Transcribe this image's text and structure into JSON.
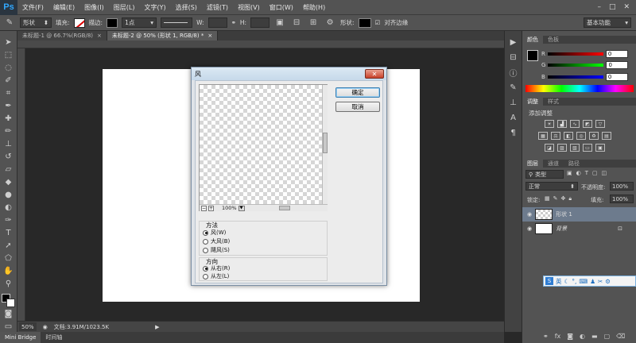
{
  "app": {
    "logo": "Ps"
  },
  "menu": [
    "文件(F)",
    "编辑(E)",
    "图像(I)",
    "图层(L)",
    "文字(Y)",
    "选择(S)",
    "滤镜(T)",
    "视图(V)",
    "窗口(W)",
    "帮助(H)"
  ],
  "window_controls": [
    "–",
    "□",
    "✕"
  ],
  "options": {
    "mode": "形状",
    "fill_label": "填充:",
    "stroke_label": "描边:",
    "stroke_size": "1点",
    "w_label": "W:",
    "h_label": "H:",
    "shape_label": "形状:",
    "align_edges_label": "对齐边缘",
    "workspace": "基本功能"
  },
  "tabs": [
    {
      "label": "未标题-1 @ 66.7%(RGB/8)",
      "close": "×"
    },
    {
      "label": "未标题-2 @ 50% (形状 1, RGB/8) *",
      "close": "×"
    }
  ],
  "status": {
    "zoom": "50%",
    "doc_info": "文档:3.91M/1023.5K"
  },
  "bottom_tabs": [
    "Mini Bridge",
    "时间轴"
  ],
  "dialog": {
    "title": "风",
    "close": "✕",
    "ok": "确定",
    "cancel": "取消",
    "zoom": "100%",
    "zoom_out": "−",
    "zoom_in": "+",
    "method": {
      "title": "方法",
      "options": [
        {
          "label": "风(W)",
          "selected": true
        },
        {
          "label": "大风(B)",
          "selected": false
        },
        {
          "label": "飓风(S)",
          "selected": false
        }
      ]
    },
    "direction": {
      "title": "方向",
      "options": [
        {
          "label": "从右(R)",
          "selected": true
        },
        {
          "label": "从左(L)",
          "selected": false
        }
      ]
    }
  },
  "color_panel": {
    "tabs": [
      "颜色",
      "色板"
    ],
    "channels": [
      {
        "label": "R",
        "value": "0",
        "gradient_color": "#ff0000"
      },
      {
        "label": "G",
        "value": "0",
        "gradient_color": "#00ff00"
      },
      {
        "label": "B",
        "value": "0",
        "gradient_color": "#0000ff"
      }
    ]
  },
  "adjust_panel": {
    "tabs": [
      "调整",
      "样式"
    ],
    "title": "添加调整"
  },
  "layers_panel": {
    "tabs": [
      "图层",
      "通道",
      "路径"
    ],
    "filter": "类型",
    "blend_mode": "正常",
    "opacity_label": "不透明度:",
    "opacity": "100%",
    "lock_label": "锁定:",
    "fill_label": "填充:",
    "fill": "100%",
    "layers": [
      {
        "name": "形状 1",
        "selected": true
      },
      {
        "name": "背景",
        "selected": false
      }
    ]
  },
  "ime": {
    "mode": "英"
  }
}
